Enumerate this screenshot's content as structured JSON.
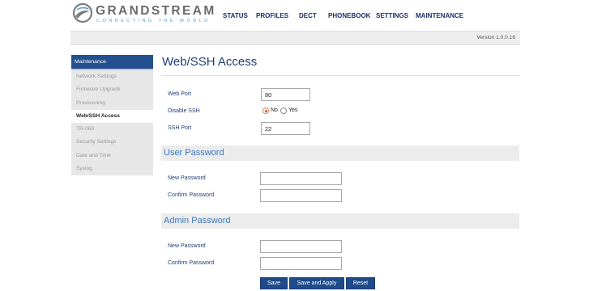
{
  "brand": {
    "name": "GRANDSTREAM",
    "tagline": "CONNECTING THE WORLD",
    "logo_icon": "grandstream-logo-icon"
  },
  "topnav": {
    "items": [
      {
        "label": "STATUS"
      },
      {
        "label": "PROFILES"
      },
      {
        "label": "DECT"
      },
      {
        "label": "PHONEBOOK"
      },
      {
        "label": "SETTINGS"
      },
      {
        "label": "MAINTENANCE"
      }
    ]
  },
  "version": "Version 1.0.0.16",
  "sidebar": {
    "header": "Maintenance",
    "items": [
      {
        "label": "Network Settings",
        "active": false
      },
      {
        "label": "Firmware Upgrade",
        "active": false
      },
      {
        "label": "Provisioning",
        "active": false
      },
      {
        "label": "Web/SSH Access",
        "active": true
      },
      {
        "label": "TR-069",
        "active": false
      },
      {
        "label": "Security Settings",
        "active": false
      },
      {
        "label": "Date and Time",
        "active": false
      },
      {
        "label": "Syslog",
        "active": false
      }
    ]
  },
  "page": {
    "title": "Web/SSH Access",
    "web_port": {
      "label": "Web Port",
      "value": "80"
    },
    "disable_ssh": {
      "label": "Disable SSH",
      "options": [
        "No",
        "Yes"
      ],
      "selected": "No"
    },
    "ssh_port": {
      "label": "SSH Port",
      "value": "22"
    },
    "user_password": {
      "section_title": "User Password",
      "new_label": "New Password",
      "confirm_label": "Confirm Password",
      "new_value": "",
      "confirm_value": ""
    },
    "admin_password": {
      "section_title": "Admin Password",
      "new_label": "New Password",
      "confirm_label": "Confirm Password",
      "new_value": "",
      "confirm_value": ""
    }
  },
  "buttons": {
    "save": "Save",
    "save_apply": "Save and Apply",
    "reset": "Reset"
  },
  "colors": {
    "nav_text": "#1c2f6e",
    "sidebar_header": "#25508f",
    "section_title": "#3a78c2",
    "button": "#1f4b8a",
    "radio_selected": "#d8552a"
  }
}
